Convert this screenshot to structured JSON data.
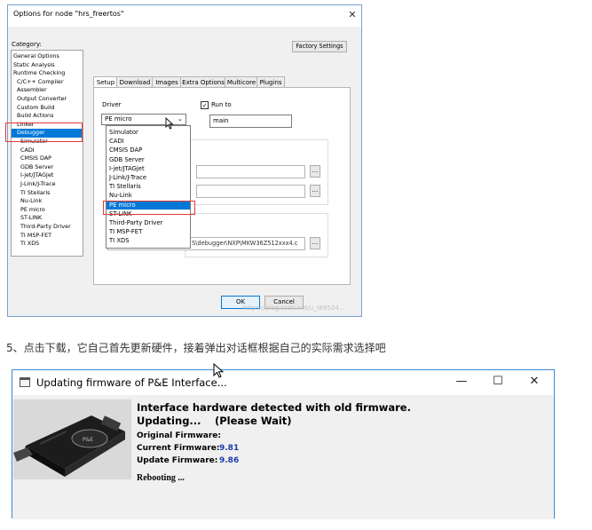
{
  "options_dialog": {
    "title": "Options for node \"hrs_freertos\"",
    "close_glyph": "✕",
    "category_label": "Category:",
    "categories": [
      "General Options",
      "Static Analysis",
      "Runtime Checking",
      "C/C++ Compiler",
      "Assembler",
      "Output Converter",
      "Custom Build",
      "Build Actions",
      "Linker",
      "Debugger",
      "Simulator",
      "CADI",
      "CMSIS DAP",
      "GDB Server",
      "I-jet/JTAGjet",
      "J-Link/J-Trace",
      "TI Stellaris",
      "Nu-Link",
      "PE micro",
      "ST-LINK",
      "Third-Party Driver",
      "TI MSP-FET",
      "TI XDS"
    ],
    "selected_category": "Debugger",
    "factory_settings": "Factory Settings",
    "tabs": [
      "Setup",
      "Download",
      "Images",
      "Extra Options",
      "Multicore",
      "Plugins"
    ],
    "active_tab": "Setup",
    "driver_label": "Driver",
    "driver_value": "PE micro",
    "run_to_label": "Run to",
    "run_to_checked": true,
    "run_to_value": "main",
    "driver_options": [
      "Simulator",
      "CADI",
      "CMSIS DAP",
      "GDB Server",
      "I-jet/JTAGjet",
      "J-Link/J-Trace",
      "TI Stellaris",
      "Nu-Link",
      "PE micro",
      "ST-LINK",
      "Third-Party Driver",
      "TI MSP-FET",
      "TI XDS"
    ],
    "highlighted_option": "PE micro",
    "path_partial": "S\\debugger\\NXP\\MKW36Z512xxx4.c",
    "browse_label": "...",
    "ok_label": "OK",
    "cancel_label": "Cancel",
    "watermark": "https://blog.csdn.net/u_t69524...",
    "highlight_color": "#0078d7",
    "annotation_color": "#e53935"
  },
  "caption": "5、点击下载，它自己首先更新硬件，接着弹出对话框根据自己的实际需求选择吧",
  "update_dialog": {
    "title": "Updating firmware of P&E Interface...",
    "minimize_glyph": "—",
    "maximize_glyph": "☐",
    "close_glyph": "✕",
    "headline": "Interface hardware detected with old firmware.",
    "updating": "Updating...",
    "please_wait": "(Please Wait)",
    "original_label": "Original Firmware:",
    "current_label": "Current Firmware:",
    "current_value": "9.81",
    "update_label": "Update Firmware:",
    "update_value": "9.86",
    "rebooting": "Rebooting ...",
    "value_color": "#1e3aa8"
  }
}
